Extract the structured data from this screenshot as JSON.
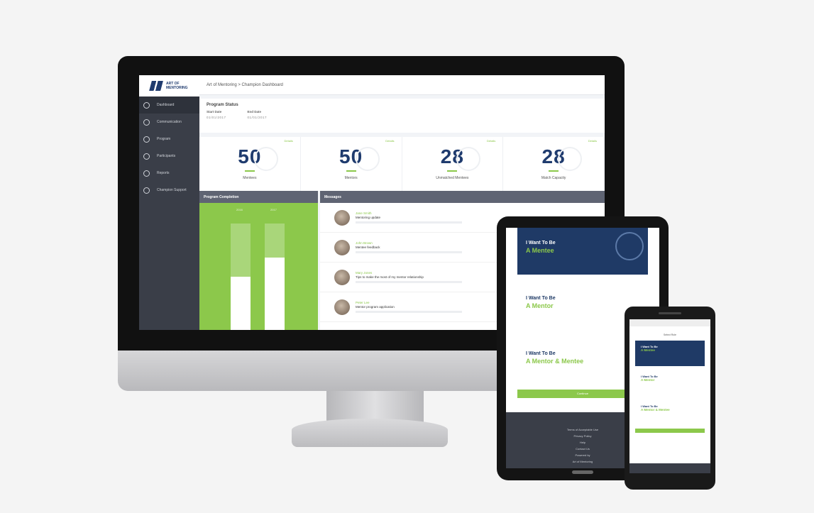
{
  "desktop": {
    "breadcrumb": "Art of Mentoring > Champion Dashboard",
    "sidebar": [
      {
        "label": "Dashboard",
        "icon": "home-icon",
        "active": true
      },
      {
        "label": "Communication",
        "icon": "chat-icon"
      },
      {
        "label": "Program",
        "icon": "program-icon"
      },
      {
        "label": "Participants",
        "icon": "people-icon"
      },
      {
        "label": "Reports",
        "icon": "report-icon"
      },
      {
        "label": "Champion Support",
        "icon": "support-icon"
      }
    ],
    "program_status": {
      "title": "Program Status",
      "start_label": "Start Date",
      "start_value": "01/01/2017",
      "end_label": "End Date",
      "end_value": "01/01/2017"
    },
    "stats": [
      {
        "value": "50",
        "label": "Mentees",
        "tag": "Details"
      },
      {
        "value": "50",
        "label": "Mentors",
        "tag": "Details"
      },
      {
        "value": "28",
        "label": "Unmatched Mentees",
        "tag": "Details"
      },
      {
        "value": "28",
        "label": "Match Capacity",
        "tag": "Details"
      }
    ],
    "panels": {
      "completion": "Program Completion",
      "messages": "Messages"
    },
    "completion_bars": [
      {
        "label": "2016",
        "fill": 0.5
      },
      {
        "label": "2017",
        "fill": 0.68
      }
    ],
    "messages": [
      {
        "name": "Jane Smith",
        "subject": "Mentoring update"
      },
      {
        "name": "John Brown",
        "subject": "Mentee feedback"
      },
      {
        "name": "Mary Jones",
        "subject": "Tips to make the most of my mentor relationship"
      },
      {
        "name": "Peter Lee",
        "subject": "Mentor program application"
      }
    ]
  },
  "tablet": {
    "cards": [
      {
        "line1": "I Want To Be",
        "line2": "A Mentee"
      },
      {
        "line1": "I Want To Be",
        "line2": "A Mentor"
      },
      {
        "line1": "I Want To Be",
        "line2": "A Mentor & Mentee"
      }
    ],
    "button": "Continue",
    "footer": [
      "Terms of Acceptable Use",
      "Privacy Policy",
      "Help",
      "Contact Us",
      "Powered by",
      "Art of Mentoring"
    ]
  },
  "phone": {
    "top": "Select Role",
    "cards": [
      {
        "line1": "I Want To Be",
        "line2": "A Mentee"
      },
      {
        "line1": "I Want To Be",
        "line2": "A Mentor"
      },
      {
        "line1": "I Want To Be",
        "line2": "A Mentor & Mentee"
      }
    ]
  }
}
